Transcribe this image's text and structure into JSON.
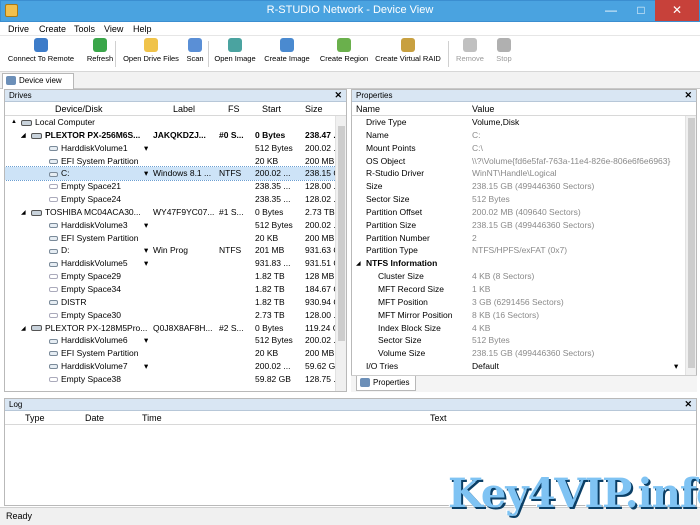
{
  "window": {
    "title": "R-STUDIO Network - Device View",
    "min": "—",
    "max": "□",
    "close": "✕"
  },
  "menu": [
    "Drive",
    "Create",
    "Tools",
    "View",
    "Help"
  ],
  "toolbar": [
    {
      "label": "Connect To Remote",
      "icon": "computer-network-icon",
      "color": "#3d7cc9",
      "enabled": true
    },
    {
      "label": "Refresh",
      "icon": "refresh-icon",
      "color": "#3aa64a",
      "enabled": true
    },
    {
      "label": "Open Drive Files",
      "icon": "open-folder-icon",
      "color": "#f0c34a",
      "enabled": true
    },
    {
      "label": "Scan",
      "icon": "scan-icon",
      "color": "#5a8fd6",
      "enabled": true
    },
    {
      "label": "Open Image",
      "icon": "open-image-icon",
      "color": "#4aa3a0",
      "enabled": true
    },
    {
      "label": "Create Image",
      "icon": "create-image-icon",
      "color": "#4a8ad0",
      "enabled": true
    },
    {
      "label": "Create Region",
      "icon": "create-region-icon",
      "color": "#6ab04c",
      "enabled": true
    },
    {
      "label": "Create Virtual RAID",
      "icon": "raid-icon",
      "color": "#c8a040",
      "enabled": true
    },
    {
      "label": "Remove",
      "icon": "remove-icon",
      "color": "#c0c0c0",
      "enabled": false
    },
    {
      "label": "Stop",
      "icon": "stop-icon",
      "color": "#b0b0b0",
      "enabled": false
    }
  ],
  "tabs": {
    "device_view": "Device view",
    "properties": "Properties"
  },
  "drives": {
    "title": "Drives",
    "columns": [
      "Device/Disk",
      "Label",
      "FS",
      "Start",
      "Size"
    ],
    "rows": [
      {
        "indent": 0,
        "type": "computer",
        "name": "Local Computer",
        "label": "",
        "fs": "",
        "start": "",
        "size": "",
        "bold": false,
        "expand": "▲"
      },
      {
        "indent": 1,
        "type": "disk",
        "name": "PLEXTOR PX-256M6S...",
        "label": "JAKQKDZJ...",
        "fs": "#0 S...",
        "start": "0 Bytes",
        "size": "238.47 ...",
        "bold": true,
        "expand": "◢"
      },
      {
        "indent": 2,
        "type": "part",
        "name": "HarddiskVolume1",
        "label": "",
        "fs": "",
        "start": "512 Bytes",
        "size": "200.02 ...",
        "bold": false,
        "drop": "▾"
      },
      {
        "indent": 2,
        "type": "part",
        "name": "EFI System Partition",
        "label": "",
        "fs": "",
        "start": "20 KB",
        "size": "200 MB",
        "bold": false
      },
      {
        "indent": 2,
        "type": "part",
        "name": "C:",
        "label": "Windows 8.1 ...",
        "fs": "NTFS",
        "start": "200.02 ...",
        "size": "238.15 GB",
        "bold": false,
        "sel": true,
        "drop": "▾"
      },
      {
        "indent": 2,
        "type": "empty",
        "name": "Empty Space21",
        "label": "",
        "fs": "",
        "start": "238.35 ...",
        "size": "128.00 ...",
        "bold": false
      },
      {
        "indent": 2,
        "type": "empty",
        "name": "Empty Space24",
        "label": "",
        "fs": "",
        "start": "238.35 ...",
        "size": "128.02 ...",
        "bold": false
      },
      {
        "indent": 1,
        "type": "disk",
        "name": "TOSHIBA MC04ACA30...",
        "label": "WY47F9YC07...",
        "fs": "#1 S...",
        "start": "0 Bytes",
        "size": "2.73 TB",
        "bold": false,
        "expand": "◢"
      },
      {
        "indent": 2,
        "type": "part",
        "name": "HarddiskVolume3",
        "label": "",
        "fs": "",
        "start": "512 Bytes",
        "size": "200.02 ...",
        "bold": false,
        "drop": "▾"
      },
      {
        "indent": 2,
        "type": "part",
        "name": "EFI System Partition",
        "label": "",
        "fs": "",
        "start": "20 KB",
        "size": "200 MB",
        "bold": false
      },
      {
        "indent": 2,
        "type": "part",
        "name": "D:",
        "label": "Win Prog",
        "fs": "NTFS",
        "start": "201 MB",
        "size": "931.63 GB",
        "bold": false,
        "drop": "▾"
      },
      {
        "indent": 2,
        "type": "part",
        "name": "HarddiskVolume5",
        "label": "",
        "fs": "",
        "start": "931.83 ...",
        "size": "931.51 GB",
        "bold": false,
        "drop": "▾"
      },
      {
        "indent": 2,
        "type": "empty",
        "name": "Empty Space29",
        "label": "",
        "fs": "",
        "start": "1.82 TB",
        "size": "128 MB",
        "bold": false
      },
      {
        "indent": 2,
        "type": "empty",
        "name": "Empty Space34",
        "label": "",
        "fs": "",
        "start": "1.82 TB",
        "size": "184.67 GB",
        "bold": false
      },
      {
        "indent": 2,
        "type": "part",
        "name": "DISTR",
        "label": "",
        "fs": "",
        "start": "1.82 TB",
        "size": "930.94 GB",
        "bold": false
      },
      {
        "indent": 2,
        "type": "empty",
        "name": "Empty Space30",
        "label": "",
        "fs": "",
        "start": "2.73 TB",
        "size": "128.00 ...",
        "bold": false
      },
      {
        "indent": 1,
        "type": "disk",
        "name": "PLEXTOR PX-128M5Pro...",
        "label": "Q0J8X8AF8H...",
        "fs": "#2 S...",
        "start": "0 Bytes",
        "size": "119.24 GB",
        "bold": false,
        "expand": "◢"
      },
      {
        "indent": 2,
        "type": "part",
        "name": "HarddiskVolume6",
        "label": "",
        "fs": "",
        "start": "512 Bytes",
        "size": "200.02 ...",
        "bold": false,
        "drop": "▾"
      },
      {
        "indent": 2,
        "type": "part",
        "name": "EFI System Partition",
        "label": "",
        "fs": "",
        "start": "20 KB",
        "size": "200 MB",
        "bold": false
      },
      {
        "indent": 2,
        "type": "part",
        "name": "HarddiskVolume7",
        "label": "",
        "fs": "",
        "start": "200.02 ...",
        "size": "59.62 GB",
        "bold": false,
        "drop": "▾"
      },
      {
        "indent": 2,
        "type": "empty",
        "name": "Empty Space38",
        "label": "",
        "fs": "",
        "start": "59.82 GB",
        "size": "128.75 ...",
        "bold": false
      }
    ]
  },
  "properties": {
    "title": "Properties",
    "columns": [
      "Name",
      "Value"
    ],
    "rows": [
      {
        "indent": 1,
        "name": "Drive Type",
        "value": "Volume,Disk",
        "dim": false
      },
      {
        "indent": 1,
        "name": "Name",
        "value": "C:",
        "dim": true
      },
      {
        "indent": 1,
        "name": "Mount Points",
        "value": "C:\\",
        "dim": true
      },
      {
        "indent": 1,
        "name": "OS Object",
        "value": "\\\\?\\Volume{fd6e5faf-763a-11e4-826e-806e6f6e6963}",
        "dim": true
      },
      {
        "indent": 1,
        "name": "R-Studio Driver",
        "value": "WinNT\\Handle\\Logical",
        "dim": true
      },
      {
        "indent": 1,
        "name": "Size",
        "value": "238.15 GB (499446360 Sectors)",
        "dim": true
      },
      {
        "indent": 1,
        "name": "Sector Size",
        "value": "512 Bytes",
        "dim": true
      },
      {
        "indent": 1,
        "name": "Partition Offset",
        "value": "200.02 MB (409640 Sectors)",
        "dim": true
      },
      {
        "indent": 1,
        "name": "Partition Size",
        "value": "238.15 GB (499446360 Sectors)",
        "dim": true
      },
      {
        "indent": 1,
        "name": "Partition Number",
        "value": "2",
        "dim": true
      },
      {
        "indent": 1,
        "name": "Partition Type",
        "value": "NTFS/HPFS/exFAT (0x7)",
        "dim": true
      },
      {
        "indent": 0,
        "name": "NTFS Information",
        "value": "",
        "dim": false,
        "group": true
      },
      {
        "indent": 2,
        "name": "Cluster Size",
        "value": "4 KB (8 Sectors)",
        "dim": true
      },
      {
        "indent": 2,
        "name": "MFT Record Size",
        "value": "1 KB",
        "dim": true
      },
      {
        "indent": 2,
        "name": "MFT Position",
        "value": "3 GB (6291456 Sectors)",
        "dim": true
      },
      {
        "indent": 2,
        "name": "MFT Mirror Position",
        "value": "8 KB (16 Sectors)",
        "dim": true
      },
      {
        "indent": 2,
        "name": "Index Block Size",
        "value": "4 KB",
        "dim": true
      },
      {
        "indent": 2,
        "name": "Sector Size",
        "value": "512 Bytes",
        "dim": true
      },
      {
        "indent": 2,
        "name": "Volume Size",
        "value": "238.15 GB (499446360 Sectors)",
        "dim": true
      },
      {
        "indent": 1,
        "name": "I/O Tries",
        "value": "Default",
        "dim": false,
        "drop": "▾"
      }
    ]
  },
  "log": {
    "title": "Log",
    "columns": [
      "Type",
      "Date",
      "Time",
      "Text"
    ]
  },
  "status": "Ready",
  "watermark": "Key4VIP.info"
}
